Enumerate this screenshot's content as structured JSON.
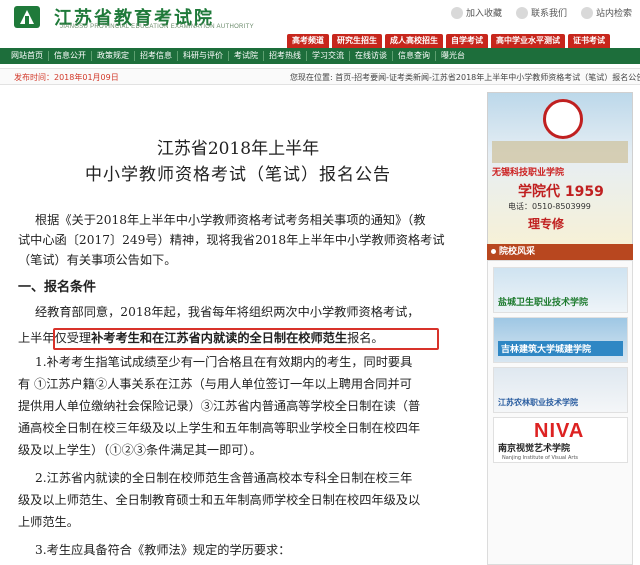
{
  "header": {
    "site_title": "江苏省教育考试院",
    "site_subtitle": "JIANGSU PROVINCIAL EDUCATION EXAMINATION AUTHORITY",
    "top_links": [
      "加入收藏",
      "联系我们",
      "站内检索"
    ]
  },
  "main_tabs": [
    "高考频道",
    "研究生招生",
    "成人高校招生",
    "自学考试",
    "高中学业水平测试",
    "证书考试"
  ],
  "sub_nav": [
    "网站首页",
    "信息公开",
    "政策规定",
    "招考信息",
    "科研与评价",
    "考试院",
    "招考热线",
    "学习交流",
    "在线访谈",
    "信息查询",
    "曝光台"
  ],
  "info_bar": {
    "publish_time": "发布时间：2018年01月09日",
    "breadcrumb": "您现在位置: 首页-招考要闻-证考类新闻-江苏省2018年上半年中小学教师资格考试（笔试）报名公告"
  },
  "article": {
    "title_line1": "江苏省2018年上半年",
    "title_line2": "中小学教师资格考试（笔试）报名公告",
    "intro_lines": [
      "根据《关于2018年上半年中小学教师资格考试考务相关事项的通知》（教",
      "试中心函〔2017〕249号）精神，现将我省2018年上半年中小学教师资格考试",
      "（笔试）有关事项公告如下。"
    ],
    "section1": "一、报名条件",
    "para1_line1": "经教育部同意，2018年起，我省每年将组织两次中小学教师资格考试，",
    "para1_line2_prefix": "上半年",
    "para1_line2_plain": "仅受理",
    "para1_line2_bold": "补考考生和在江苏省内就读的全日制在校师范生",
    "para1_line2_suffix": "报名。",
    "item1_lines": [
      "1.补考考生指笔试成绩至少有一门合格且在有效期内的考生，同时要具",
      "有 ①江苏户籍②人事关系在江苏（与用人单位签订一年以上聘用合同并可",
      "提供用人单位缴纳社会保险记录）③江苏省内普通高等学校全日制在读（普",
      "通高校全日制在校三年级及以上学生和五年制高等职业学校全日制在校四年",
      "级及以上学生）（①②③条件满足其一即可）。"
    ],
    "item2_lines": [
      "2.江苏省内就读的全日制在校师范生含普通高校本专科全日制在校三年",
      "级及以上师范生、全日制教育硕士和五年制高师学校全日制在校四年级及以",
      "上师范生。"
    ],
    "item3_line": "3.考生应具备符合《教师法》规定的学历要求："
  },
  "sidebar": {
    "ad": {
      "school_name": "无锡科技职业学院",
      "year_text": "学院代 1959",
      "phone": "电话：0510-8503999",
      "slogan": "理专修"
    },
    "panel_title": "院校风采",
    "schools": [
      "盐城卫生职业技术学院",
      "吉林建筑大学城建学院",
      "江苏农林职业技术学院",
      "南京视觉艺术学院"
    ],
    "niva_text": "NIVA",
    "niva_sub": "Nanjing Institute of Visual Arts"
  }
}
